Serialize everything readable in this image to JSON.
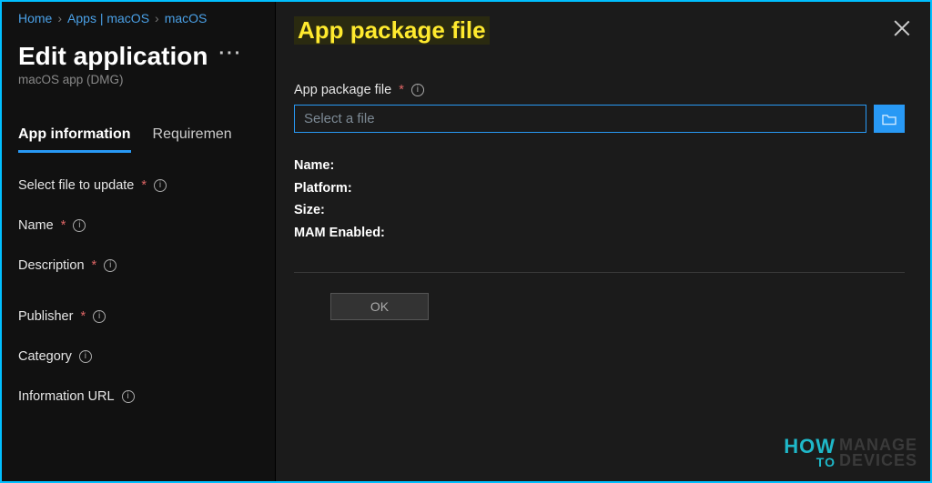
{
  "breadcrumb": {
    "home": "Home",
    "apps": "Apps | macOS",
    "macos": "macOS"
  },
  "page": {
    "title": "Edit application",
    "subtitle": "macOS app (DMG)"
  },
  "tabs": {
    "info": "App information",
    "req": "Requiremen"
  },
  "fields": {
    "select_file": "Select file to update",
    "name": "Name",
    "description": "Description",
    "publisher": "Publisher",
    "category": "Category",
    "info_url": "Information URL"
  },
  "flyout": {
    "title": "App package file",
    "label": "App package file",
    "placeholder": "Select a file",
    "meta": {
      "name_label": "Name:",
      "name_value": "",
      "platform_label": "Platform:",
      "platform_value": "",
      "size_label": "Size:",
      "size_value": "",
      "mam_label": "MAM Enabled:",
      "mam_value": ""
    },
    "ok": "OK"
  },
  "watermark": {
    "how": "HOW",
    "to": "TO",
    "manage": "MANAGE",
    "devices": "DEVICES"
  }
}
